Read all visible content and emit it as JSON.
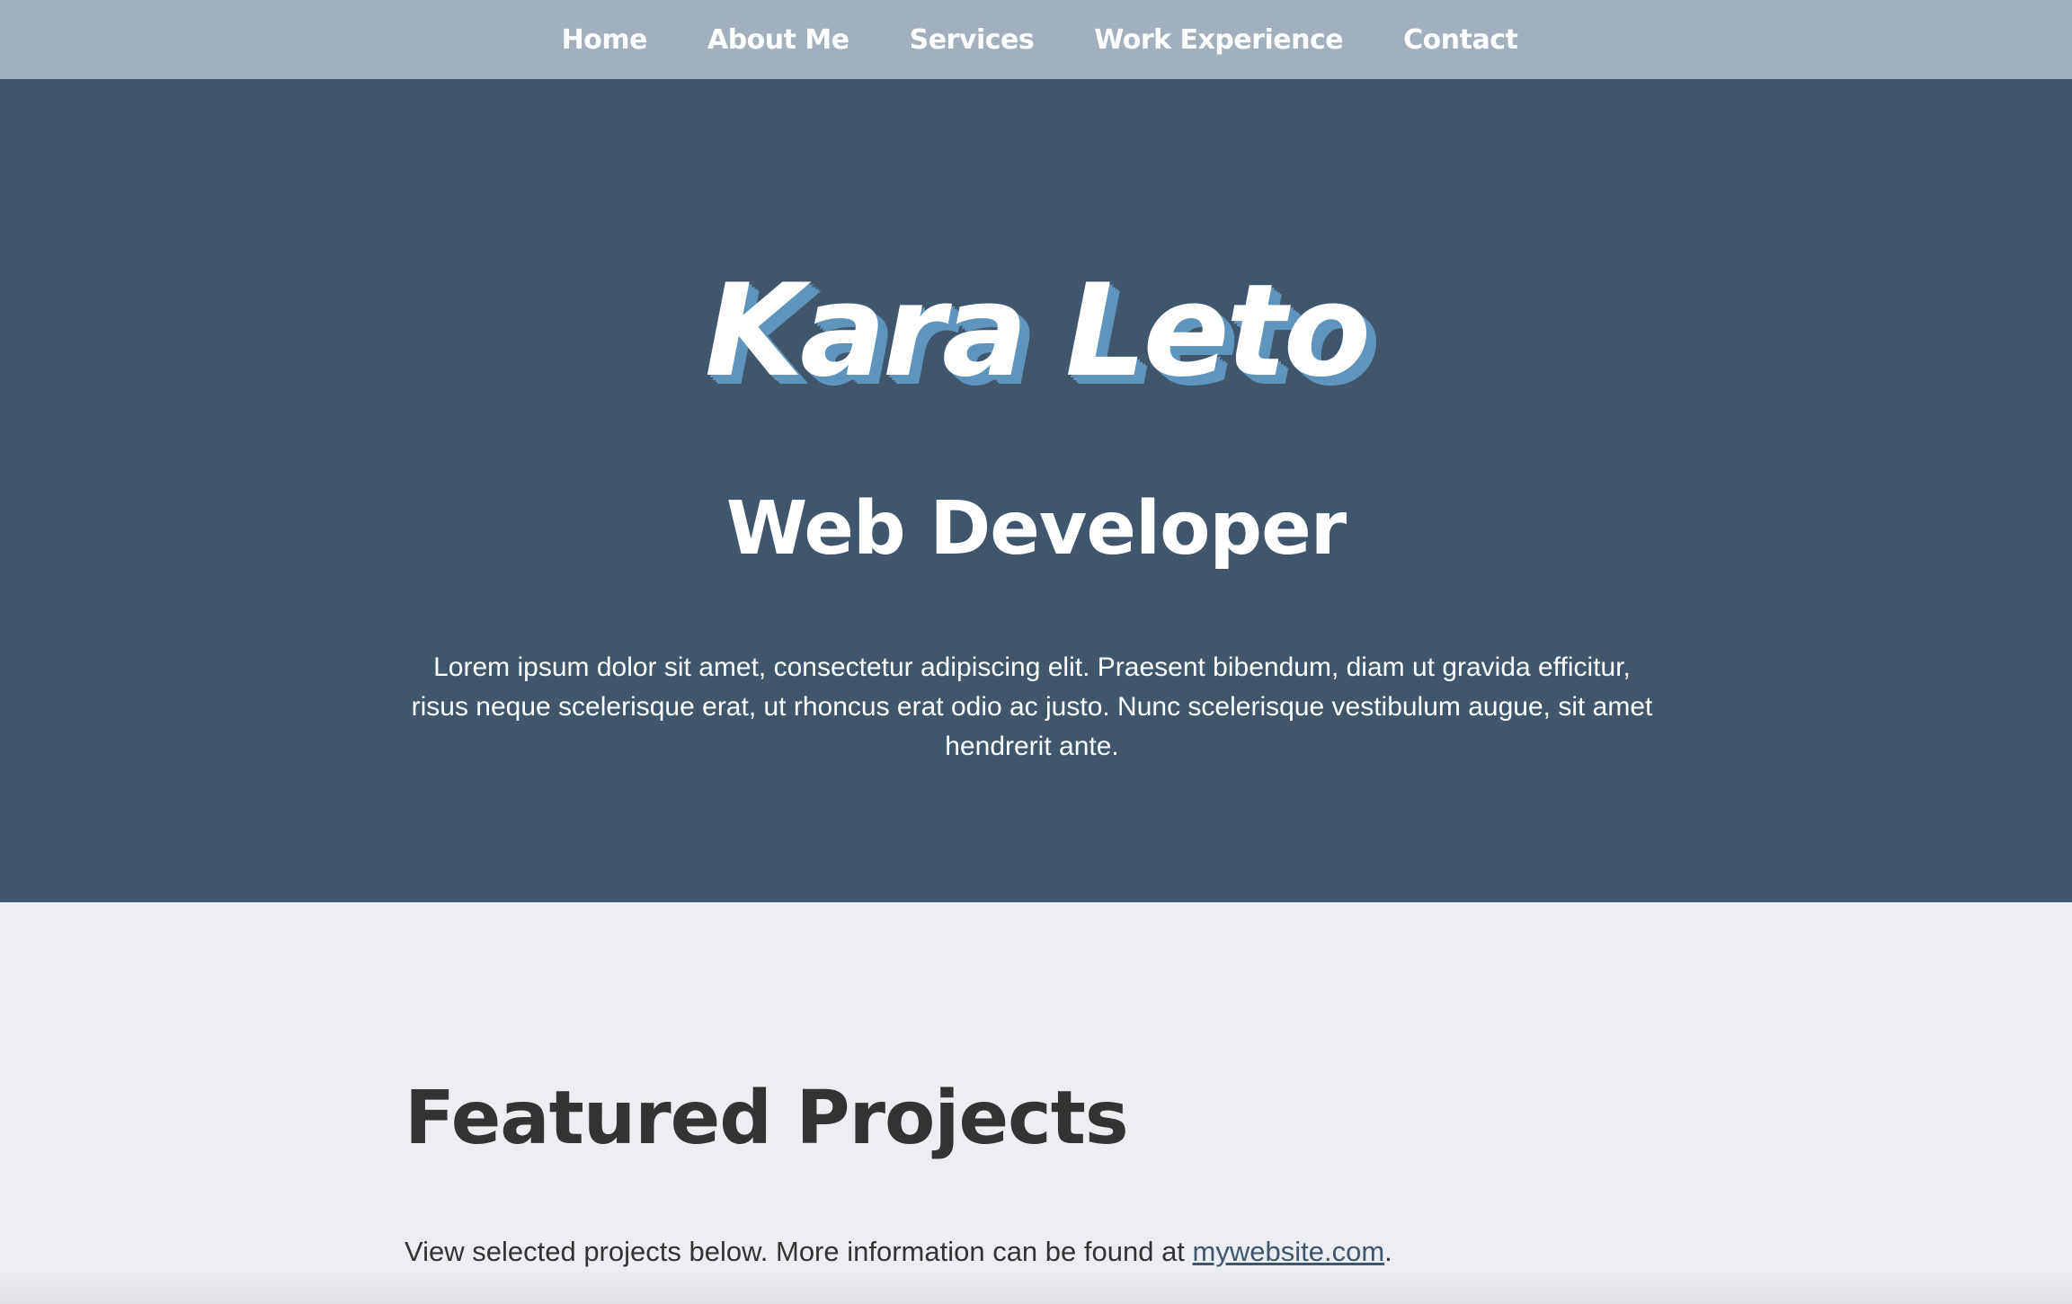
{
  "nav": {
    "items": [
      {
        "label": "Home"
      },
      {
        "label": "About Me"
      },
      {
        "label": "Services"
      },
      {
        "label": "Work Experience"
      },
      {
        "label": "Contact"
      }
    ]
  },
  "hero": {
    "name": "Kara Leto",
    "title": "Web Developer",
    "description": "Lorem ipsum dolor sit amet, consectetur adipiscing elit. Praesent bibendum, diam ut gravida efficitur, risus neque scelerisque erat, ut rhoncus erat odio ac justo. Nunc scelerisque vestibulum augue, sit amet hendrerit ante."
  },
  "projects": {
    "heading": "Featured Projects",
    "intro_text": "View selected projects below. More information can be found at ",
    "link_text": "mywebsite.com",
    "intro_suffix": "."
  },
  "colors": {
    "nav_background": "#a2b0bd",
    "hero_background": "#40566d",
    "name_shadow": "#5f95bd",
    "page_background": "#edeef1",
    "heading_text": "#333333"
  }
}
